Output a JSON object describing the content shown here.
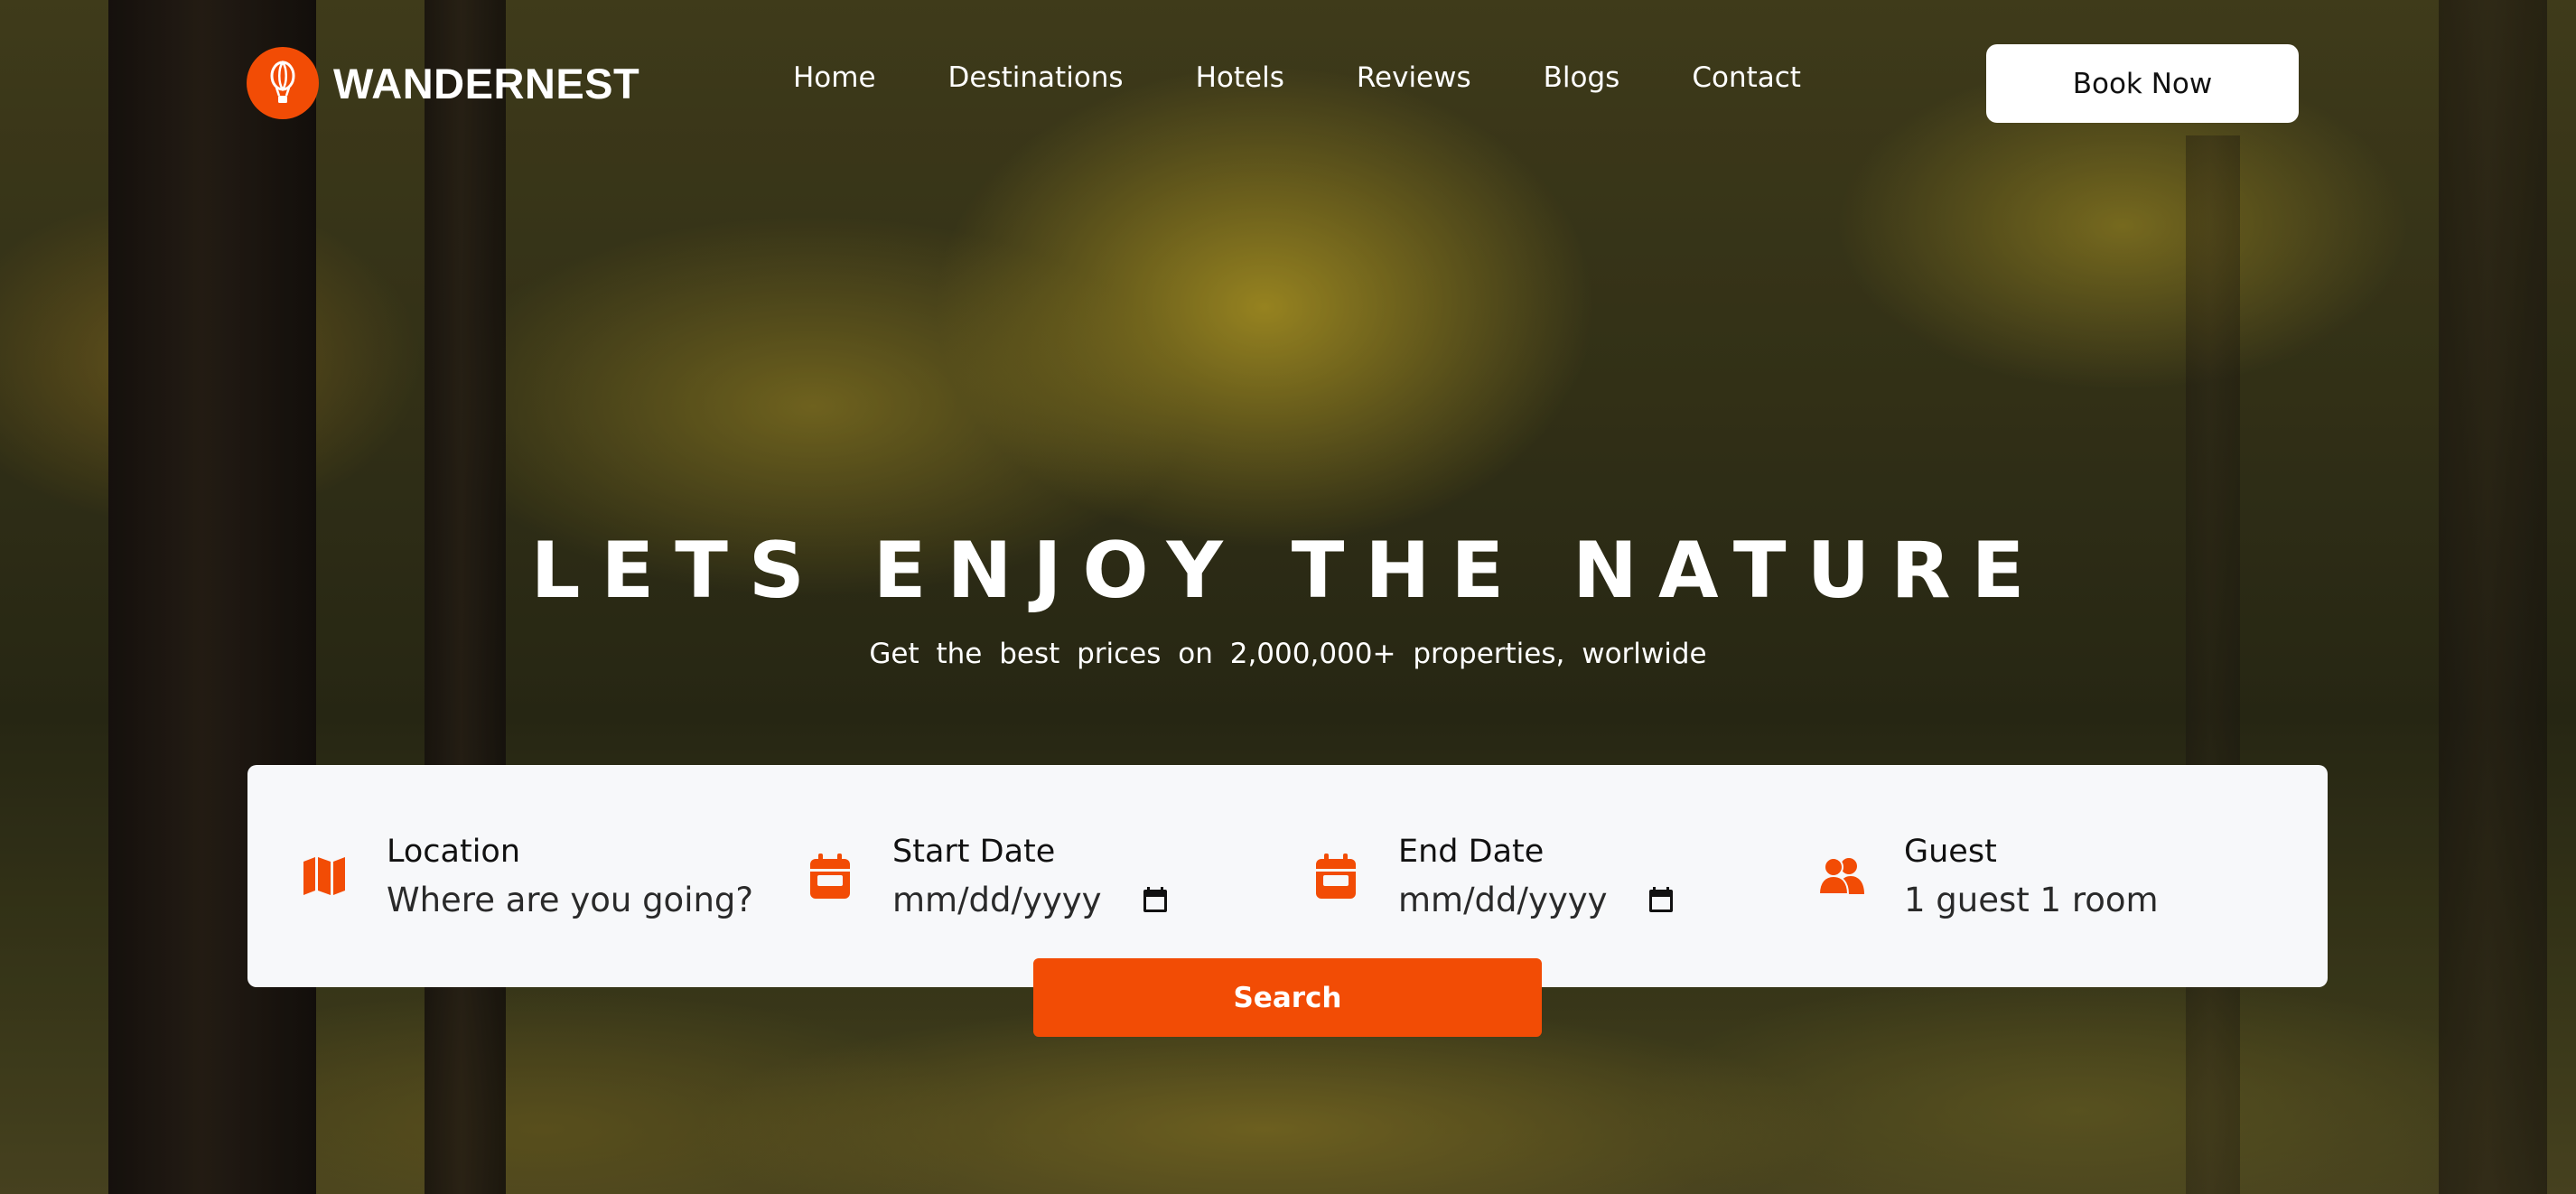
{
  "brand": {
    "name": "WANDERNEST",
    "icon": "hot-air-balloon-icon",
    "accent": "#f24c05"
  },
  "nav": {
    "items": [
      "Home",
      "Destinations",
      "Hotels",
      "Reviews",
      "Blogs",
      "Contact"
    ],
    "book_now": "Book Now"
  },
  "hero": {
    "title": "LETS ENJOY THE NATURE",
    "subtitle": "Get the best prices on 2,000,000+ properties, worlwide"
  },
  "search": {
    "location": {
      "label": "Location",
      "placeholder": "Where are you going?",
      "icon": "map-icon"
    },
    "start_date": {
      "label": "Start Date",
      "value": "mm/dd/yyyy",
      "icon": "calendar-icon"
    },
    "end_date": {
      "label": "End Date",
      "value": "mm/dd/yyyy",
      "icon": "calendar-icon"
    },
    "guest": {
      "label": "Guest",
      "value": "1 guest 1 room",
      "icon": "users-icon"
    },
    "button": "Search"
  }
}
